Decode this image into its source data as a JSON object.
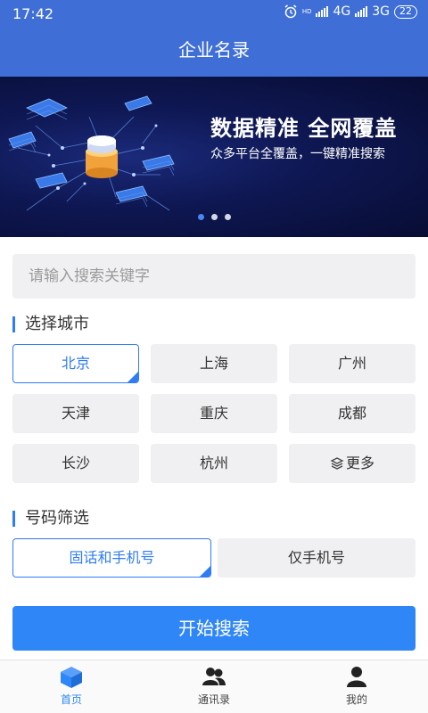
{
  "status_bar": {
    "time": "17:42",
    "network_1": "4G",
    "network_2": "3G",
    "battery": "22",
    "hd_label": "HD"
  },
  "header": {
    "title": "企业名录"
  },
  "banner": {
    "headline": "数据精准 全网覆盖",
    "subline": "众多平台全覆盖，一键精准搜索",
    "slide_count": 3,
    "active_slide": 1
  },
  "search": {
    "placeholder": "请输入搜索关键字",
    "value": ""
  },
  "city_section": {
    "title": "选择城市",
    "cities": [
      {
        "label": "北京",
        "selected": true
      },
      {
        "label": "上海",
        "selected": false
      },
      {
        "label": "广州",
        "selected": false
      },
      {
        "label": "天津",
        "selected": false
      },
      {
        "label": "重庆",
        "selected": false
      },
      {
        "label": "成都",
        "selected": false
      },
      {
        "label": "长沙",
        "selected": false
      },
      {
        "label": "杭州",
        "selected": false
      },
      {
        "label": "更多",
        "selected": false,
        "icon": "layers-icon"
      }
    ]
  },
  "number_filter": {
    "title": "号码筛选",
    "options": [
      {
        "label": "固话和手机号",
        "selected": true
      },
      {
        "label": "仅手机号",
        "selected": false
      }
    ]
  },
  "actions": {
    "start_search_label": "开始搜索"
  },
  "tabbar": {
    "items": [
      {
        "label": "首页",
        "icon": "cube-icon",
        "active": true
      },
      {
        "label": "通讯录",
        "icon": "contacts-icon",
        "active": false
      },
      {
        "label": "我的",
        "icon": "person-icon",
        "active": false
      }
    ]
  },
  "colors": {
    "primary": "#2f86f6",
    "header": "#3f6fd6",
    "banner_bg": "#0e1752",
    "chip_bg": "#f0f0f2"
  }
}
